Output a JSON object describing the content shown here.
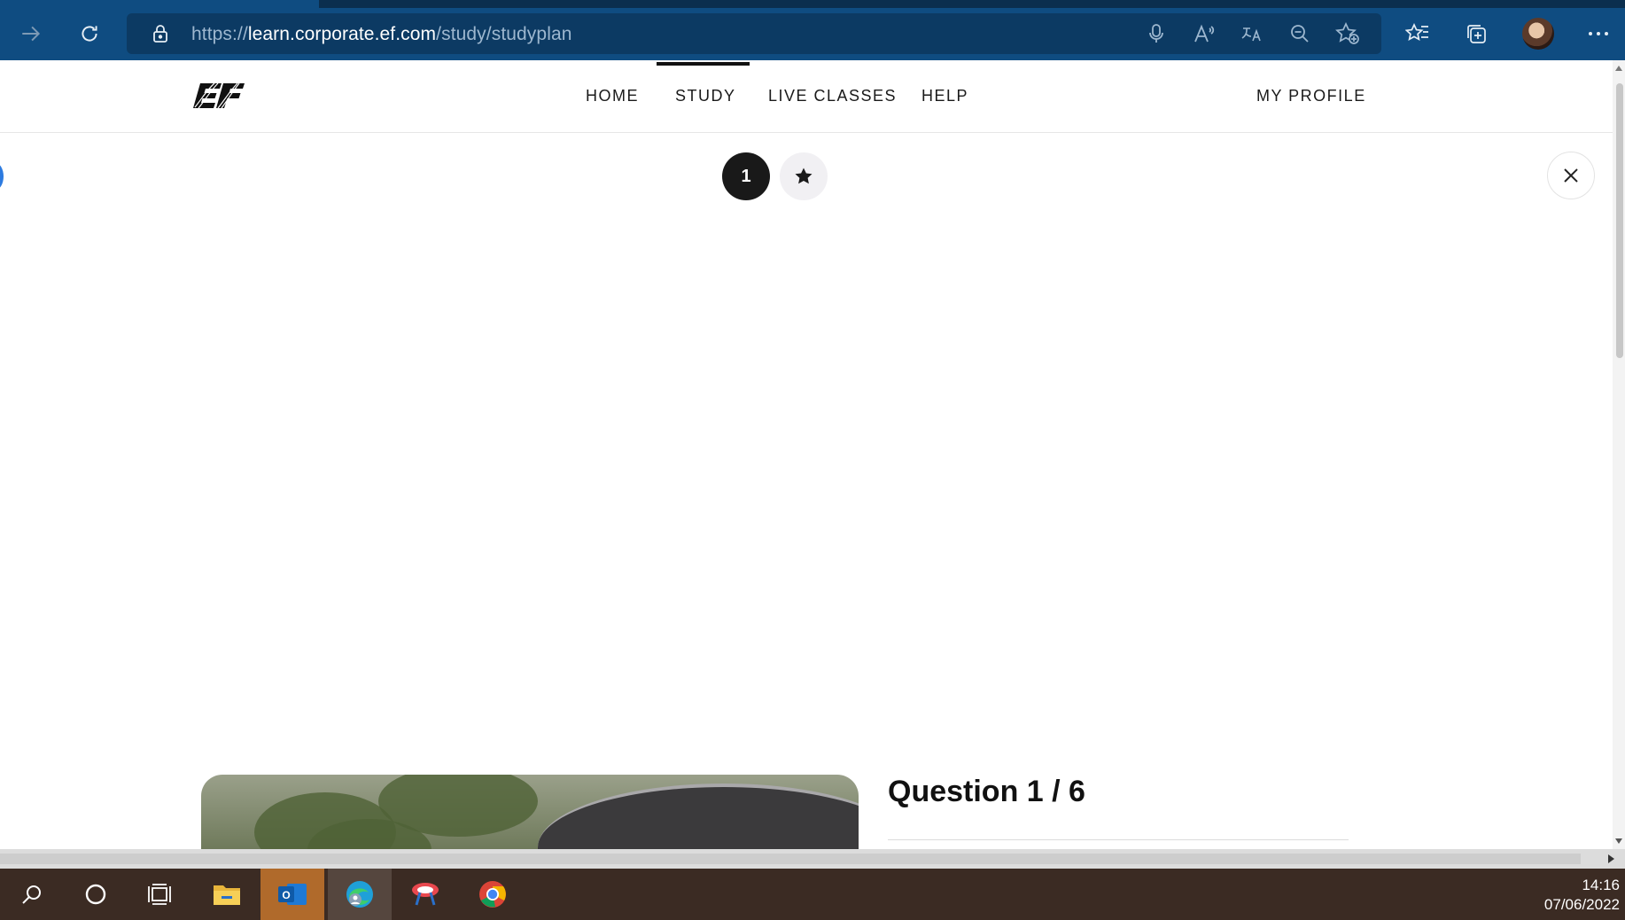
{
  "browser": {
    "url_scheme": "https://",
    "url_host": "learn.corporate.ef.com",
    "url_path": "/study/studyplan",
    "icons": [
      "forward-icon",
      "refresh-icon",
      "lock-icon",
      "microphone-icon",
      "read-aloud-icon",
      "translate-icon",
      "zoom-out-icon",
      "add-favorite-icon",
      "favorites-icon",
      "collections-icon",
      "avatar",
      "more-icon"
    ]
  },
  "nav": {
    "home": "HOME",
    "study": "STUDY",
    "live_classes": "LIVE CLASSES",
    "help": "HELP",
    "profile": "MY PROFILE",
    "active": "STUDY"
  },
  "lesson": {
    "step_number": "1",
    "question_title": "Question 1 / 6"
  },
  "taskbar": {
    "time": "14:16",
    "date": "07/06/2022"
  },
  "colors": {
    "browser_chrome": "#0f4c81",
    "taskbar": "#3b2b23",
    "step_active": "#191919"
  }
}
